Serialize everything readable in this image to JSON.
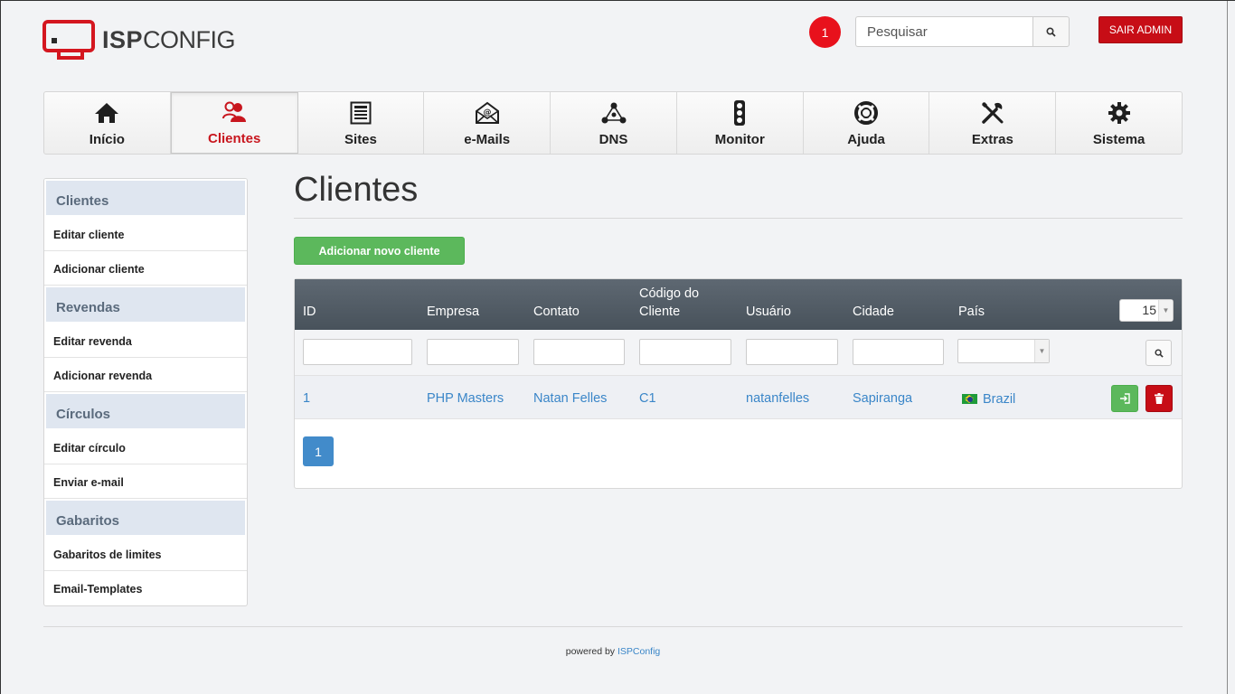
{
  "brand": {
    "bold": "ISP",
    "light": "CONFIG"
  },
  "header": {
    "notification_count": "1",
    "search_placeholder": "Pesquisar",
    "logout_label": "SAIR ADMIN"
  },
  "nav": {
    "tabs": [
      {
        "label": "Início",
        "icon": "home-icon"
      },
      {
        "label": "Clientes",
        "icon": "users-icon",
        "active": true
      },
      {
        "label": "Sites",
        "icon": "website-icon"
      },
      {
        "label": "e-Mails",
        "icon": "envelope-icon"
      },
      {
        "label": "DNS",
        "icon": "dns-nodes-icon"
      },
      {
        "label": "Monitor",
        "icon": "traffic-light-icon"
      },
      {
        "label": "Ajuda",
        "icon": "lifebuoy-icon"
      },
      {
        "label": "Extras",
        "icon": "tools-icon"
      },
      {
        "label": "Sistema",
        "icon": "gear-icon"
      }
    ]
  },
  "sidebar": {
    "sections": [
      {
        "title": "Clientes",
        "items": [
          "Editar cliente",
          "Adicionar cliente"
        ]
      },
      {
        "title": "Revendas",
        "items": [
          "Editar revenda",
          "Adicionar revenda"
        ]
      },
      {
        "title": "Círculos",
        "items": [
          "Editar círculo",
          "Enviar e-mail"
        ]
      },
      {
        "title": "Gabaritos",
        "items": [
          "Gabaritos de limites",
          "Email-Templates"
        ]
      }
    ]
  },
  "main": {
    "title": "Clientes",
    "add_button": "Adicionar novo cliente",
    "table": {
      "columns": [
        "ID",
        "Empresa",
        "Contato",
        "Código do Cliente",
        "Usuário",
        "Cidade",
        "País"
      ],
      "page_size": "15",
      "rows": [
        {
          "id": "1",
          "empresa": "PHP Masters",
          "contato": "Natan Felles",
          "codigo": "C1",
          "usuario": "natanfelles",
          "cidade": "Sapiranga",
          "pais": "Brazil"
        }
      ]
    },
    "pagination": {
      "current": "1"
    }
  },
  "footer": {
    "prefix": "powered by",
    "link": "ISPConfig"
  },
  "colors": {
    "accent_red": "#c70d16",
    "link_blue": "#3a86c8",
    "success_green": "#5cb85c",
    "primary_blue": "#428bca"
  }
}
